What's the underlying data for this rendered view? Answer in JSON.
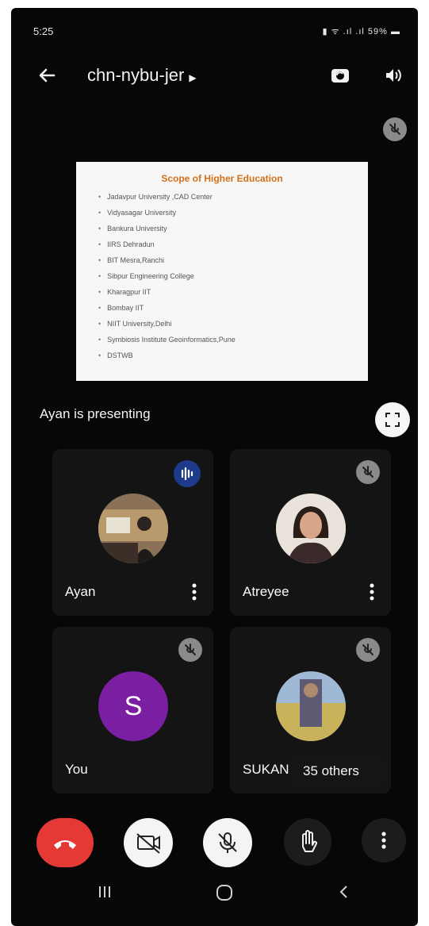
{
  "status_bar": {
    "time": "5:25",
    "right": "59%"
  },
  "meeting": {
    "code": "chn-nybu-jer"
  },
  "slide": {
    "title": "Scope of Higher Education",
    "items": [
      "Jadavpur University ,CAD Center",
      "Vidyasagar University",
      "Bankura University",
      "IIRS Dehradun",
      "BIT Mesra,Ranchi",
      "Sibpur Engineering College",
      "Kharagpur IIT",
      "Bombay IIT",
      "NIIT University,Delhi",
      "Symbiosis Institute Geoinformatics,Pune",
      "DSTWB"
    ]
  },
  "presenting_text": "Ayan is presenting",
  "participants": [
    {
      "name": "Ayan",
      "state": "speaking"
    },
    {
      "name": "Atreyee",
      "state": "muted"
    },
    {
      "name": "You",
      "initial": "S",
      "state": "muted"
    },
    {
      "name": "SUKAN",
      "state": "muted"
    }
  ],
  "others_label": "35 others",
  "colors": {
    "end_call": "#e53935",
    "avatar_you": "#7b1fa2",
    "speaking": "#1e3a8a",
    "slide_title": "#d4701a"
  },
  "icons": [
    "back-arrow-icon",
    "switch-camera-icon",
    "speaker-icon",
    "mic-off-icon",
    "fullscreen-icon",
    "audio-wave-icon",
    "more-vert-icon",
    "end-call-icon",
    "camera-off-icon",
    "raise-hand-icon"
  ]
}
